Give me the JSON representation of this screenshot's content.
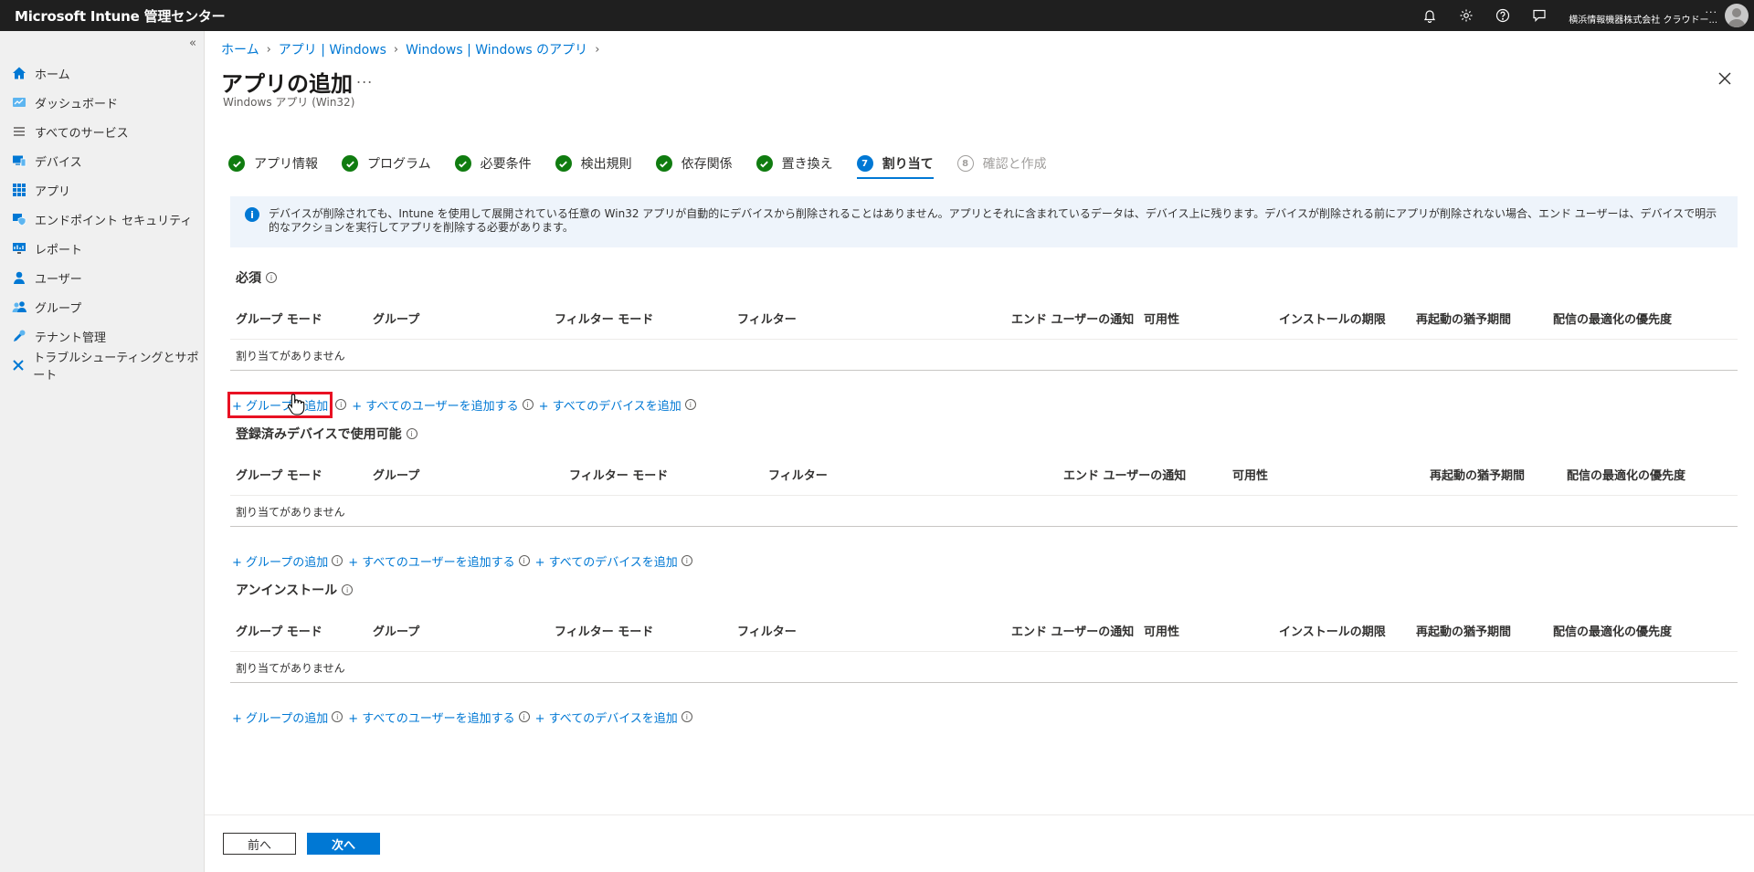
{
  "topbar": {
    "title": "Microsoft Intune 管理センター",
    "tenant_dots": "...",
    "tenant_name": "横浜情報機器株式会社 クラウドー..."
  },
  "sidebar": {
    "collapse": "«",
    "items": [
      {
        "label": "ホーム",
        "icon": "home-icon"
      },
      {
        "label": "ダッシュボード",
        "icon": "dashboard-icon"
      },
      {
        "label": "すべてのサービス",
        "icon": "all-services-icon"
      },
      {
        "label": "デバイス",
        "icon": "device-icon"
      },
      {
        "label": "アプリ",
        "icon": "apps-icon"
      },
      {
        "label": "エンドポイント セキュリティ",
        "icon": "endpoint-security-icon"
      },
      {
        "label": "レポート",
        "icon": "report-icon"
      },
      {
        "label": "ユーザー",
        "icon": "user-icon"
      },
      {
        "label": "グループ",
        "icon": "group-icon"
      },
      {
        "label": "テナント管理",
        "icon": "tenant-admin-icon"
      },
      {
        "label": "トラブルシューティングとサポート",
        "icon": "troubleshooting-icon"
      }
    ]
  },
  "breadcrumb": [
    "ホーム",
    "アプリ | Windows",
    "Windows | Windows のアプリ"
  ],
  "page": {
    "title": "アプリの追加",
    "more": "...",
    "subtitle": "Windows アプリ (Win32)"
  },
  "steps": [
    {
      "label": "アプリ情報",
      "state": "done"
    },
    {
      "label": "プログラム",
      "state": "done"
    },
    {
      "label": "必要条件",
      "state": "done"
    },
    {
      "label": "検出規則",
      "state": "done"
    },
    {
      "label": "依存関係",
      "state": "done"
    },
    {
      "label": "置き換え",
      "state": "done"
    },
    {
      "label": "割り当て",
      "state": "active",
      "num": "7"
    },
    {
      "label": "確認と作成",
      "state": "pending",
      "num": "8"
    }
  ],
  "info_text": "デバイスが削除されても、Intune を使用して展開されている任意の Win32 アプリが自動的にデバイスから削除されることはありません。アプリとそれに含まれているデータは、デバイス上に残ります。デバイスが削除される前にアプリが削除されない場合、エンド ユーザーは、デバイスで明示的なアクションを実行してアプリを削除する必要があります。",
  "sections": {
    "required": {
      "title": "必須",
      "columns": [
        "グループ モード",
        "グループ",
        "フィルター モード",
        "フィルター",
        "エンド ユーザーの通知",
        "可用性",
        "インストールの期限",
        "再起動の猶予期間",
        "配信の最適化の優先度"
      ],
      "empty": "割り当てがありません"
    },
    "available": {
      "title": "登録済みデバイスで使用可能",
      "columns": [
        "グループ モード",
        "グループ",
        "フィルター モード",
        "フィルター",
        "エンド ユーザーの通知",
        "可用性",
        "再起動の猶予期間",
        "配信の最適化の優先度"
      ],
      "empty": "割り当てがありません"
    },
    "uninstall": {
      "title": "アンインストール",
      "columns": [
        "グループ モード",
        "グループ",
        "フィルター モード",
        "フィルター",
        "エンド ユーザーの通知",
        "可用性",
        "インストールの期限",
        "再起動の猶予期間",
        "配信の最適化の優先度"
      ],
      "empty": "割り当てがありません"
    }
  },
  "actions": {
    "add_group": "+ グループの追加",
    "add_all_users": "+ すべてのユーザーを追加する",
    "add_all_devices": "+ すべてのデバイスを追加"
  },
  "footer": {
    "prev": "前へ",
    "next": "次へ"
  },
  "colors": {
    "accent": "#0078d4",
    "success": "#107c10",
    "highlight": "#e81123"
  }
}
